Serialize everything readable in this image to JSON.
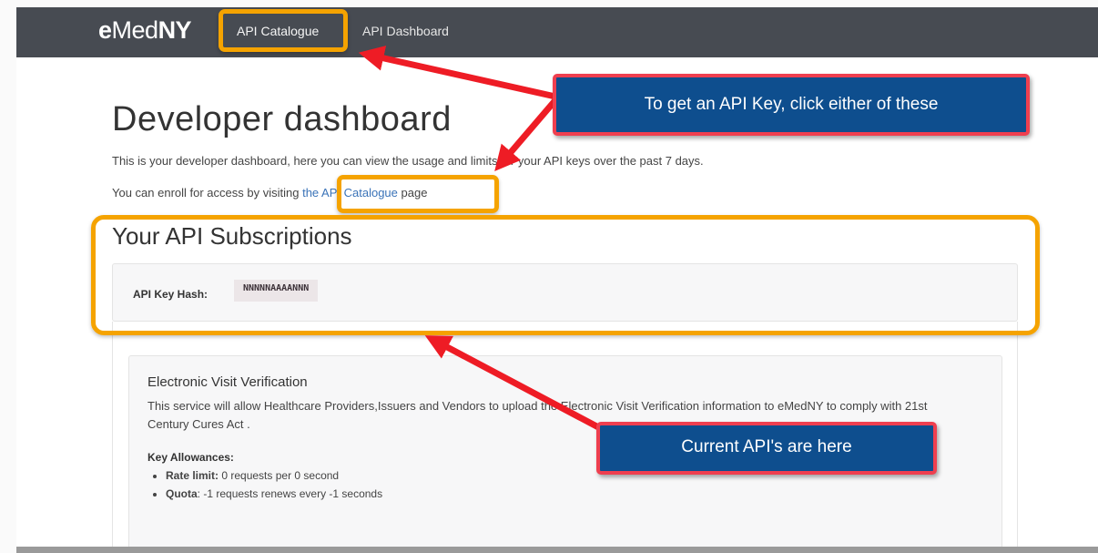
{
  "navbar": {
    "brand_e": "e",
    "brand_med": "Med",
    "brand_ny": "NY",
    "links": [
      {
        "label": "API Catalogue"
      },
      {
        "label": "API Dashboard"
      }
    ]
  },
  "page": {
    "title": "Developer dashboard",
    "intro_prefix": "This is your developer dashboard, here you can view the ",
    "intro_suffix": " usage and limits for your API keys over the past 7 days.",
    "enroll_prefix": "You can enroll for access by visiting ",
    "enroll_link": "the API Catalogue",
    "enroll_suffix": " page"
  },
  "subscriptions": {
    "heading": "Your API Subscriptions",
    "key_label": "API Key Hash:",
    "key_value": "NNNNNAAAANNN"
  },
  "api": {
    "title": "Electronic Visit Verification",
    "description": "This service will allow Healthcare Providers,Issuers and Vendors to upload the Electronic Visit Verification information to eMedNY to comply with 21st Century Cures Act .",
    "allowances_heading": "Key Allowances:",
    "rate_label": "Rate limit:",
    "rate_value": " 0 requests per 0 second",
    "quota_label": "Quota",
    "quota_value": ": -1 requests renews every -1 seconds"
  },
  "annotations": {
    "top_callout": "To get an API Key, click either of these",
    "bottom_callout": "Current API's are here"
  },
  "colors": {
    "navbar": "#474b52",
    "highlight": "#f5a300",
    "callout_fill": "#0e4e8e",
    "callout_border": "#ef3f4f",
    "arrow": "#ee1c25"
  }
}
